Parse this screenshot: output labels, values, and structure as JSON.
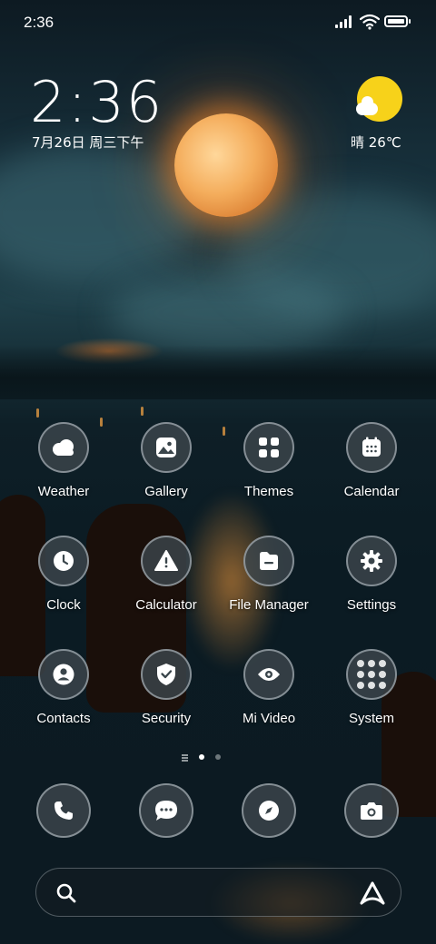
{
  "status_bar": {
    "time": "2:36"
  },
  "clock_widget": {
    "time": "2:36",
    "date": "7月26日 周三下午"
  },
  "weather_widget": {
    "text": "晴 26℃",
    "sun_color": "#f7d21a"
  },
  "apps": [
    {
      "label": "Weather",
      "icon": "weather-cloud-icon"
    },
    {
      "label": "Gallery",
      "icon": "gallery-icon"
    },
    {
      "label": "Themes",
      "icon": "themes-grid-icon"
    },
    {
      "label": "Calendar",
      "icon": "calendar-icon"
    },
    {
      "label": "Clock",
      "icon": "clock-icon"
    },
    {
      "label": "Calculator",
      "icon": "calculator-warning-icon"
    },
    {
      "label": "File Manager",
      "icon": "folder-icon"
    },
    {
      "label": "Settings",
      "icon": "gear-icon"
    },
    {
      "label": "Contacts",
      "icon": "person-icon"
    },
    {
      "label": "Security",
      "icon": "shield-check-icon"
    },
    {
      "label": "Mi Video",
      "icon": "eye-icon"
    },
    {
      "label": "System",
      "icon": "folder-grid-icon"
    }
  ],
  "dock": [
    {
      "name": "phone",
      "icon": "phone-icon"
    },
    {
      "name": "messages",
      "icon": "chat-bubble-icon"
    },
    {
      "name": "browser",
      "icon": "compass-icon"
    },
    {
      "name": "camera",
      "icon": "camera-icon"
    }
  ],
  "pager": {
    "pages": 2,
    "active": 1
  },
  "search_bar": {
    "search_icon": "search-icon",
    "assistant_icon": "assistant-a-icon"
  }
}
